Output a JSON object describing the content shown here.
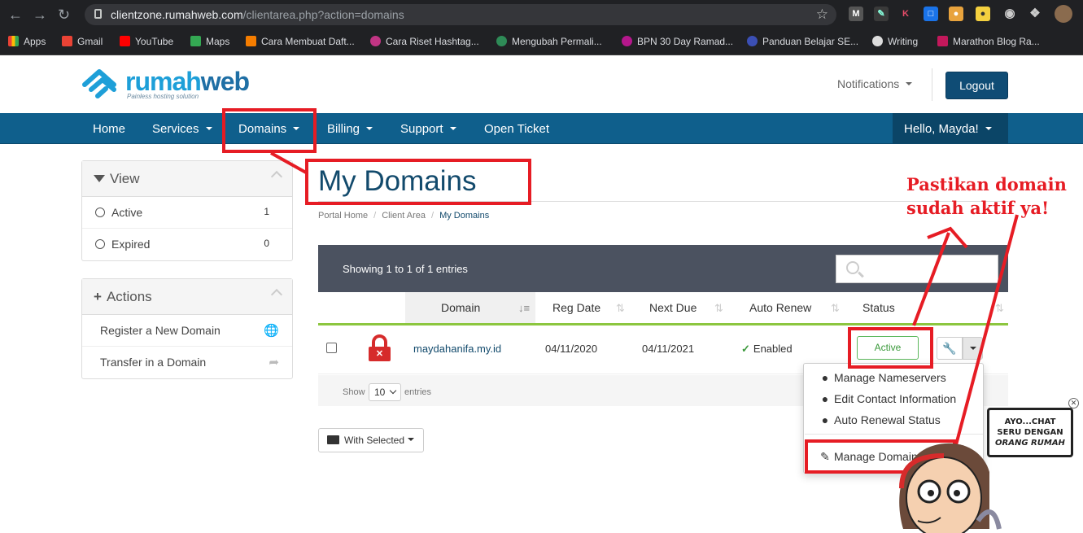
{
  "browser": {
    "url_host": "clientzone.rumahweb.com",
    "url_path": "/clientarea.php?action=domains",
    "bookmarks": [
      {
        "label": "Apps"
      },
      {
        "label": "Gmail"
      },
      {
        "label": "YouTube"
      },
      {
        "label": "Maps"
      },
      {
        "label": "Cara Membuat Daft..."
      },
      {
        "label": "Cara Riset Hashtag..."
      },
      {
        "label": "Mengubah Permali..."
      },
      {
        "label": "BPN 30 Day Ramad..."
      },
      {
        "label": "Panduan Belajar SE..."
      },
      {
        "label": "Writing"
      },
      {
        "label": "Marathon Blog Ra..."
      }
    ]
  },
  "header": {
    "logo_main": "rumah",
    "logo_accent": "web",
    "logo_tagline": "Painless hosting solution",
    "notifications": "Notifications",
    "logout": "Logout"
  },
  "nav": {
    "items": [
      "Home",
      "Services",
      "Domains",
      "Billing",
      "Support",
      "Open Ticket"
    ],
    "user": "Hello, Mayda!"
  },
  "sidebar": {
    "view_title": "View",
    "filters": [
      {
        "label": "Active",
        "count": "1"
      },
      {
        "label": "Expired",
        "count": "0"
      }
    ],
    "actions_title": "Actions",
    "actions": [
      {
        "label": "Register a New Domain"
      },
      {
        "label": "Transfer in a Domain"
      }
    ]
  },
  "page": {
    "title": "My Domains",
    "breadcrumb": [
      "Portal Home",
      "Client Area",
      "My Domains"
    ]
  },
  "table": {
    "showing": "Showing 1 to 1 of 1 entries",
    "columns": [
      "Domain",
      "Reg Date",
      "Next Due",
      "Auto Renew",
      "Status"
    ],
    "rows": [
      {
        "domain": "maydahanifa.my.id",
        "reg_date": "04/11/2020",
        "next_due": "04/11/2021",
        "auto_renew": "Enabled",
        "status": "Active"
      }
    ],
    "show_label": "Show",
    "page_size": "10",
    "entries_label": "entries",
    "with_selected": "With Selected"
  },
  "dropdown": {
    "items": [
      "Manage Nameservers",
      "Edit Contact Information",
      "Auto Renewal Status",
      "Manage Domain"
    ]
  },
  "annotation": {
    "line1": "Pastikan domain",
    "line2": "sudah aktif ya!"
  },
  "bubble": {
    "line1": "AYO...CHAT",
    "line2": "SERU DENGAN",
    "line3": "ORANG RUMAH"
  },
  "colors": {
    "brand_blue": "#0f5f8c",
    "title_blue": "#124a6c",
    "accent_green": "#8cc63f",
    "annotation_red": "#e61c24"
  }
}
